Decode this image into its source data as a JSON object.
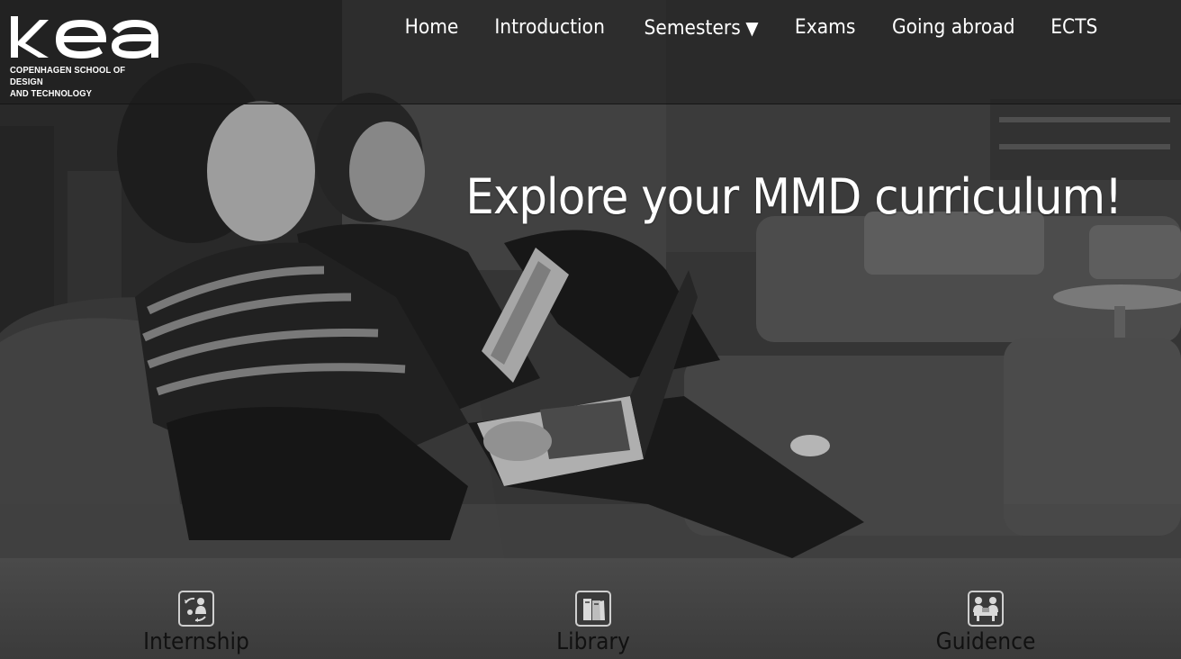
{
  "brand": {
    "wordmark": "KEA",
    "tagline_line1": "COPENHAGEN SCHOOL OF DESIGN",
    "tagline_line2": "AND TECHNOLOGY"
  },
  "nav": {
    "items": [
      {
        "label": "Home"
      },
      {
        "label": "Introduction"
      },
      {
        "label": "Semesters",
        "has_dropdown": true,
        "caret": "▼"
      },
      {
        "label": "Exams"
      },
      {
        "label": "Going abroad"
      },
      {
        "label": "ECTS"
      }
    ]
  },
  "hero": {
    "headline": "Explore your MMD curriculum!",
    "image": "students-on-sofa-photo"
  },
  "quicklinks": [
    {
      "label": "Internship",
      "icon": "internship-icon"
    },
    {
      "label": "Library",
      "icon": "library-books-icon"
    },
    {
      "label": "Guidence",
      "icon": "guidance-meeting-icon"
    }
  ],
  "colors": {
    "nav_text": "#ffffff",
    "headline": "#ffffff",
    "quicklink_text": "#111111",
    "quicklink_bg": "#444444",
    "topbar_bg": "#1e1e1e"
  }
}
